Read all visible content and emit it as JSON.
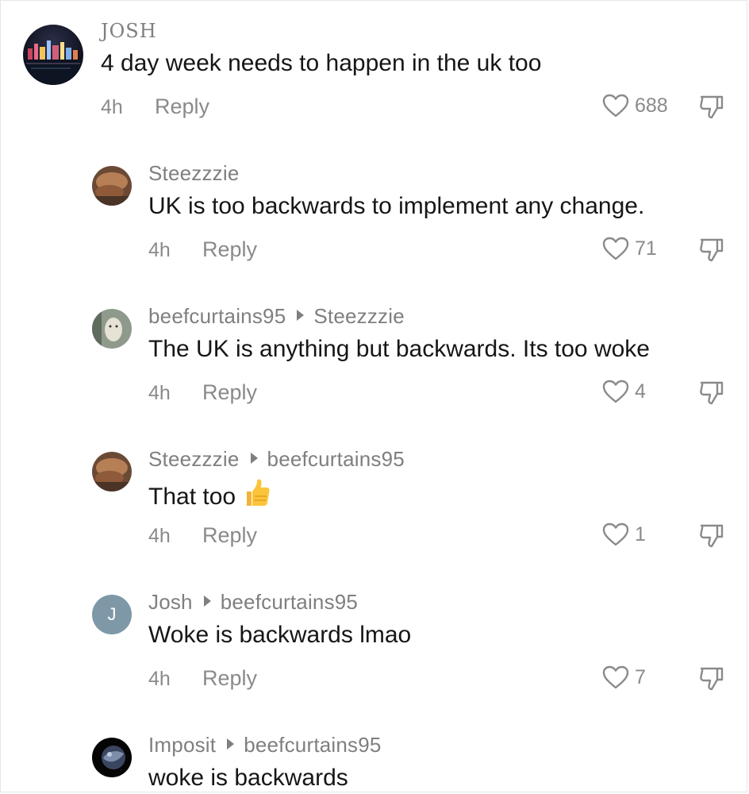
{
  "comments": [
    {
      "username": "JOSH",
      "reply_to": "",
      "text": "4 day week needs to happen in the uk too",
      "time": "4h",
      "reply_label": "Reply",
      "likes": "688",
      "avatar_icon": "city-night-avatar"
    },
    {
      "username": "Steezzzie",
      "reply_to": "",
      "text": "UK is too backwards to implement any change.",
      "time": "4h",
      "reply_label": "Reply",
      "likes": "71",
      "avatar_icon": "photo-avatar"
    },
    {
      "username": "beefcurtains95",
      "reply_to": "Steezzzie",
      "text": "The UK is anything but backwards. Its too woke",
      "time": "4h",
      "reply_label": "Reply",
      "likes": "4",
      "avatar_icon": "photo-avatar"
    },
    {
      "username": "Steezzzie",
      "reply_to": "beefcurtains95",
      "text": "That too",
      "emoji": "thumbs-up-emoji",
      "time": "4h",
      "reply_label": "Reply",
      "likes": "1",
      "avatar_icon": "photo-avatar"
    },
    {
      "username": "Josh",
      "reply_to": "beefcurtains95",
      "text": "Woke is backwards lmao",
      "time": "4h",
      "reply_label": "Reply",
      "likes": "7",
      "avatar_initial": "J",
      "avatar_color": "#7e98a7"
    },
    {
      "username": "Imposit",
      "reply_to": "beefcurtains95",
      "text": "woke is backwards",
      "avatar_icon": "planet-avatar"
    }
  ]
}
